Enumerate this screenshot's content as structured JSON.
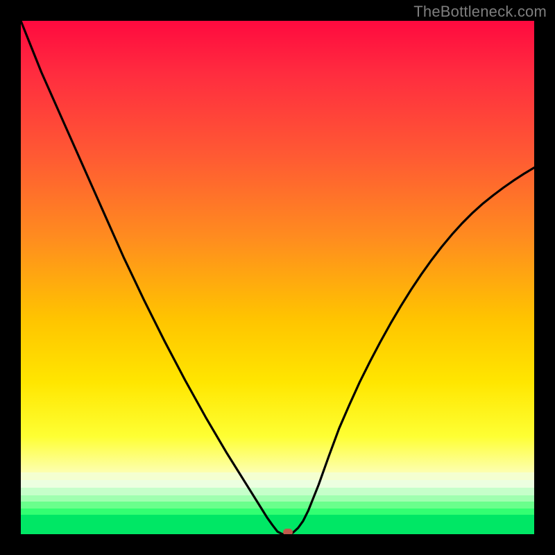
{
  "watermark": "TheBottleneck.com",
  "colors": {
    "frame": "#000000",
    "curve": "#000000",
    "marker": "#c05a4c",
    "gradient_top": "#ff0a3f",
    "gradient_bottom_band": "#00e765"
  },
  "chart_data": {
    "type": "line",
    "title": "",
    "xlabel": "",
    "ylabel": "",
    "xlim": [
      0,
      100
    ],
    "ylim": [
      0,
      100
    ],
    "legend": false,
    "grid": false,
    "x": [
      0,
      2,
      4,
      6,
      8,
      10,
      12,
      14,
      16,
      18,
      20,
      22,
      24,
      26,
      28,
      30,
      32,
      34,
      36,
      38,
      40,
      42,
      44,
      46,
      47,
      48,
      49,
      50,
      51,
      52,
      53,
      54,
      55,
      56,
      58,
      60,
      62,
      64,
      66,
      68,
      70,
      72,
      74,
      76,
      78,
      80,
      82,
      84,
      86,
      88,
      90,
      92,
      94,
      96,
      98,
      100
    ],
    "y": [
      100,
      95,
      90,
      85.5,
      81,
      76.5,
      72,
      67.5,
      63,
      58.5,
      54,
      49.8,
      45.6,
      41.6,
      37.6,
      33.8,
      30,
      26.4,
      22.8,
      19.4,
      16,
      12.8,
      9.6,
      6.4,
      4.8,
      3.2,
      1.8,
      0.5,
      0,
      0,
      0.3,
      1.2,
      2.6,
      4.6,
      9.6,
      15.2,
      20.6,
      25.2,
      29.6,
      33.6,
      37.4,
      41,
      44.4,
      47.6,
      50.6,
      53.4,
      56.0,
      58.4,
      60.6,
      62.6,
      64.4,
      66.0,
      67.5,
      68.9,
      70.2,
      71.4
    ],
    "series": [
      {
        "name": "bottleneck-curve",
        "x_ref": "x",
        "y_ref": "y"
      }
    ],
    "marker": {
      "x": 52,
      "y": 0
    },
    "bottom_flat_xrange": [
      49,
      53
    ],
    "background_bands": [
      {
        "y_from": 100,
        "y_to": 12,
        "style": "gradient-red-to-yellow"
      },
      {
        "y_from": 12,
        "y_to": 10.5,
        "style": "palegreen"
      },
      {
        "y_from": 10.5,
        "y_to": 9,
        "style": "greenwhite"
      },
      {
        "y_from": 9,
        "y_to": 7.6,
        "style": "mint2"
      },
      {
        "y_from": 7.6,
        "y_to": 6.3,
        "style": "mint1"
      },
      {
        "y_from": 6.3,
        "y_to": 5,
        "style": "green2"
      },
      {
        "y_from": 5,
        "y_to": 3.8,
        "style": "green3"
      },
      {
        "y_from": 3.8,
        "y_to": 0,
        "style": "greenfloor"
      }
    ]
  }
}
